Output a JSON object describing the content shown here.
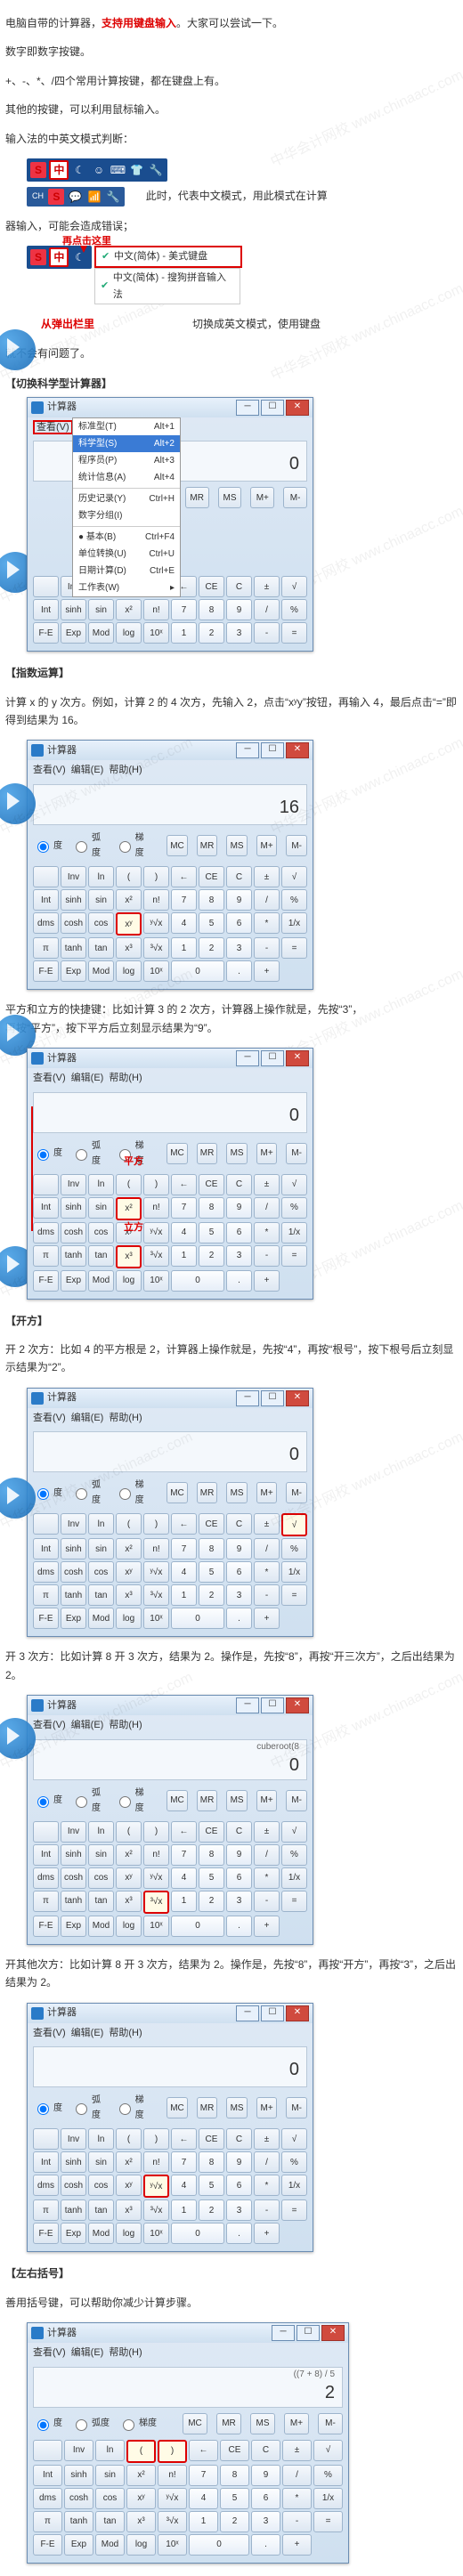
{
  "watermark": "中华会计网校 www.chinaacc.com",
  "intro": {
    "p1a": "电脑自带的计算器，",
    "p1b": "支持用键盘输入",
    "p1c": "。大家可以尝试一下。",
    "p2": "数字即数字按键。",
    "p3": "+、-、*、/四个常用计算按键，都在键盘上有。",
    "p4": "其他的按键，可以利用鼠标输入。",
    "p5": "输入法的中英文模式判断：",
    "p6a": "此时，代表中文模式，用此模式在计算",
    "p6b": "器输入，可能会造成错误；",
    "p7a": "再点击这里",
    "p7b": "从弹出栏里",
    "p7c": "切换成英文模式，使用键盘",
    "p8": "就不会有问题了。"
  },
  "ime": {
    "s_tag": "S",
    "zh": "中",
    "moon": "☾",
    "face": "☺",
    "key": "⌨",
    "shirt": "👕",
    "wrench": "🔧",
    "ch": "CH",
    "wifi": "📶",
    "menu1": "中文(简体) - 美式键盘",
    "menu2": "中文(简体) - 搜狗拼音输入法"
  },
  "sec1_title": "【切换科学型计算器】",
  "sec2": {
    "title": "【指数运算】",
    "p": "计算 x 的 y 次方。例如，计算 2 的 4 次方，先输入 2，点击“xʸy”按钮，再输入 4，最后点击“=”即得到结果为 16。",
    "p2a": "平方和立方的快捷键：比如计算 3 的 2 次方，计算器上操作就是，先按“3”，",
    "p2b": "再按“平方”，按下平方后立刻显示结果为“9”。",
    "lab_sq": "平方",
    "lab_cu": "立方"
  },
  "sec3": {
    "title": "【开方】",
    "p1": "开 2 次方：比如 4 的平方根是 2，计算器上操作就是，先按“4”，再按“根号”，按下根号后立刻显示结果为“2”。",
    "p2": "开 3 次方：比如计算 8 开 3 次方，结果为 2。操作是，先按“8”，再按“开三次方”，之后出结果为 2。",
    "p3": "开其他次方：比如计算 8 开 3 次方，结果为 2。操作是，先按“8”，再按“开方”，再按“3”，之后出结果为 2。"
  },
  "sec4": {
    "title": "【左右括号】",
    "p": "善用括号键，可以帮助你减少计算步骤。"
  },
  "calc": {
    "title": "计算器",
    "menu": {
      "v": "查看(V)",
      "e": "编辑(E)",
      "h": "帮助(H)"
    },
    "dd": {
      "std": "标准型(T)",
      "std_k": "Alt+1",
      "sci": "科学型(S)",
      "sci_k": "Alt+2",
      "prog": "程序员(P)",
      "prog_k": "Alt+3",
      "stat": "统计信息(A)",
      "stat_k": "Alt+4",
      "hist": "历史记录(Y)",
      "hist_k": "Ctrl+H",
      "grp": "数字分组(I)",
      "basic": "基本(B)",
      "basic_k": "Ctrl+F4",
      "unit": "单位转换(U)",
      "unit_k": "Ctrl+U",
      "date": "日期计算(D)",
      "date_k": "Ctrl+E",
      "ws": "工作表(W)"
    },
    "d0": "0",
    "d16": "16",
    "dcu": "cuberoot(8",
    "dbrk_top": "((7 + 8) / 5",
    "dbrk": "2",
    "ang": {
      "deg": "度",
      "rad": "弧度",
      "grad": "梯度"
    },
    "keys": {
      "blank": "",
      "Inv": "Inv",
      "ln": "ln",
      "lparen": "(",
      "rparen": ")",
      "xy": "xʸ",
      "sqrt": "√",
      "cbrt": "³√x",
      "yroot": "ʸ√x",
      "log": "log",
      "tenx": "10ˣ",
      "Int": "Int",
      "sinh": "sinh",
      "sin": "sin",
      "cosh": "cosh",
      "cos": "cos",
      "tanh": "tanh",
      "tan": "tan",
      "dms": "dms",
      "pi": "π",
      "FE": "F-E",
      "Exp": "Exp",
      "Mod": "Mod",
      "x2": "x²",
      "x3": "x³",
      "nfac": "n!",
      "MC": "MC",
      "MR": "MR",
      "MS": "MS",
      "Mp": "M+",
      "Mm": "M-",
      "bk": "←",
      "CE": "CE",
      "C": "C",
      "pm": "±",
      "7": "7",
      "8": "8",
      "9": "9",
      "4": "4",
      "5": "5",
      "6": "6",
      "1": "1",
      "2": "2",
      "3": "3",
      "0": "0",
      "dot": ".",
      "div": "/",
      "mul": "*",
      "sub": "-",
      "add": "+",
      "eq": "=",
      "pct": "%",
      "inv": "1/x"
    }
  }
}
